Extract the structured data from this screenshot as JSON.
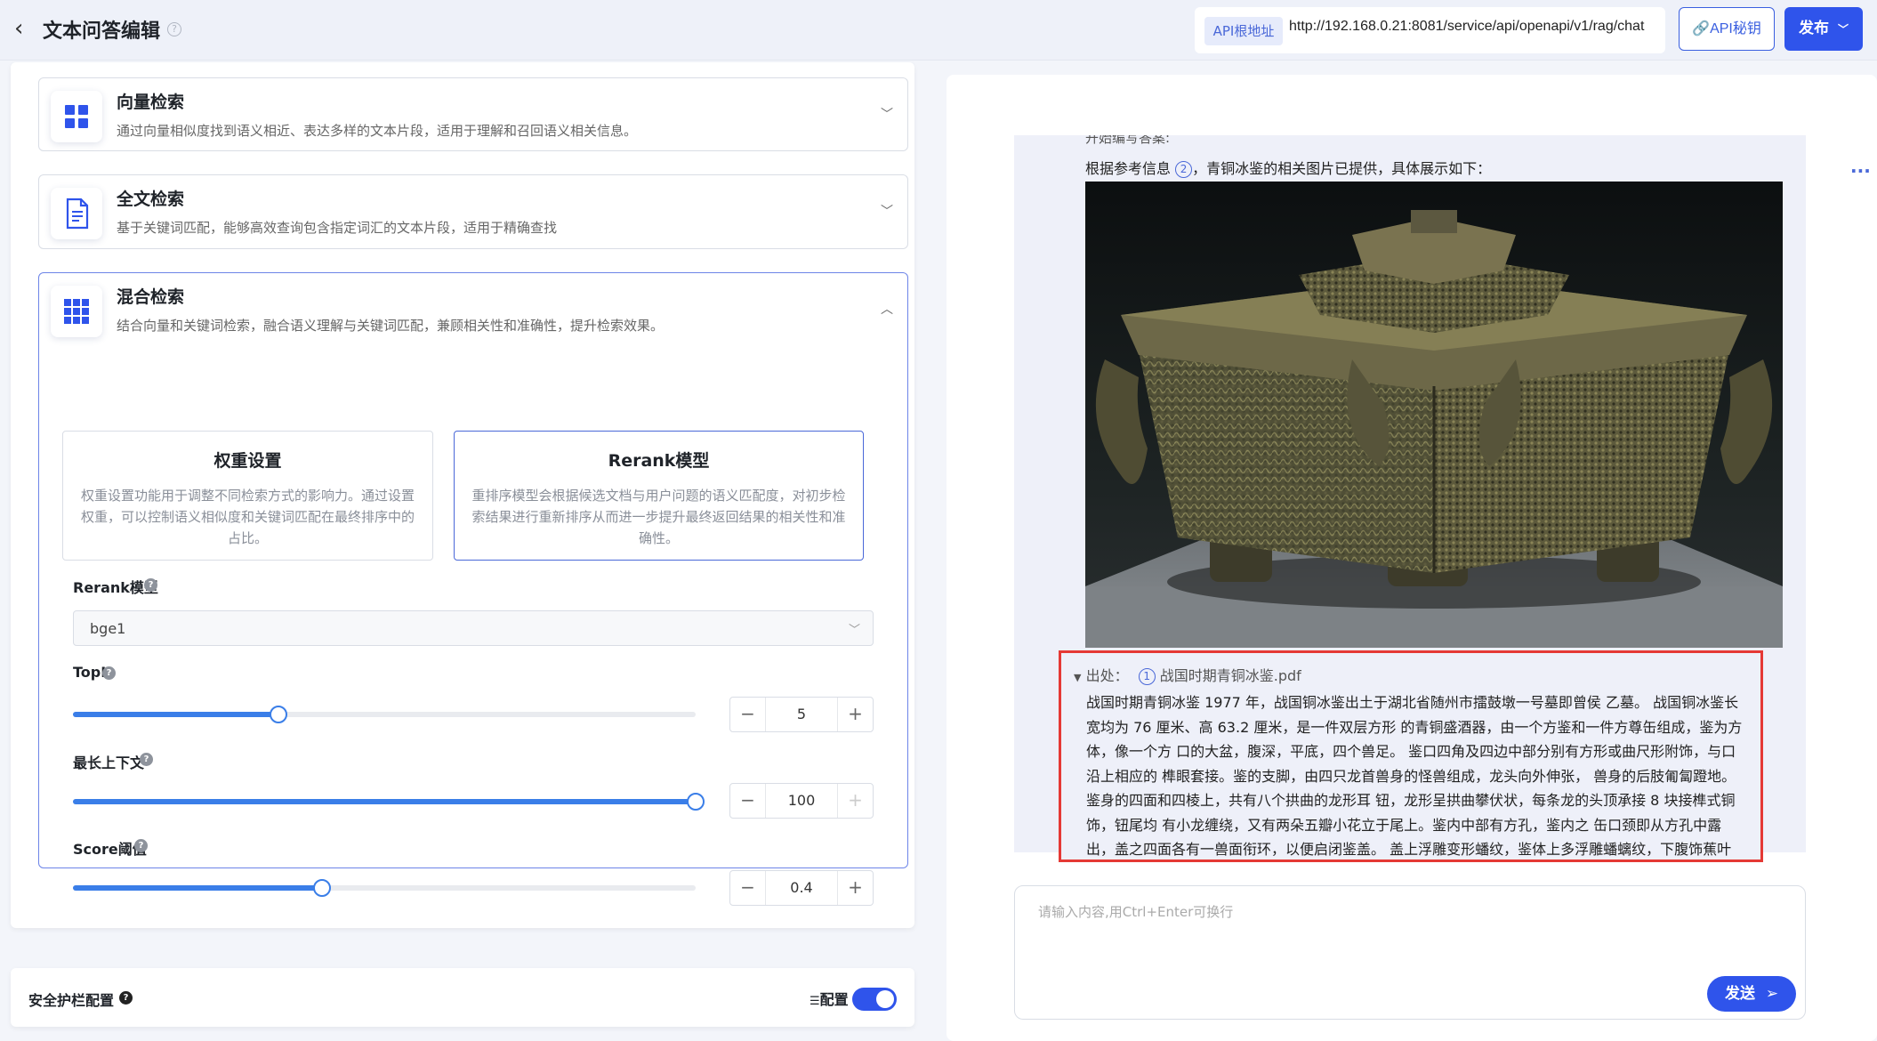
{
  "header": {
    "title": "文本问答编辑",
    "api_tag": "API根地址",
    "api_url": "http://192.168.0.21:8081/service/api/openapi/v1/rag/chat",
    "api_key_label": "API秘钥",
    "publish_label": "发布"
  },
  "retrieval": {
    "vector": {
      "title": "向量检索",
      "desc": "通过向量相似度找到语义相近、表达多样的文本片段，适用于理解和召回语义相关信息。"
    },
    "fulltext": {
      "title": "全文检索",
      "desc": "基于关键词匹配，能够高效查询包含指定词汇的文本片段，适用于精确查找"
    },
    "hybrid": {
      "title": "混合检索",
      "desc": "结合向量和关键词检索，融合语义理解与关键词匹配，兼顾相关性和准确性，提升检索效果。",
      "weight": {
        "title": "权重设置",
        "desc": "权重设置功能用于调整不同检索方式的影响力。通过设置权重，可以控制语义相似度和关键词匹配在最终排序中的占比。"
      },
      "rerank": {
        "title": "Rerank模型",
        "desc": "重排序模型会根据候选文档与用户问题的语义匹配度，对初步检索结果进行重新排序从而进一步提升最终返回结果的相关性和准确性。"
      },
      "rerank_model_label": "Rerank模型",
      "rerank_model_value": "bge1",
      "topk": {
        "label": "TopK",
        "value": "5",
        "fraction": 0.33
      },
      "max_context": {
        "label": "最长上下文",
        "value": "100",
        "fraction": 1.0
      },
      "score": {
        "label": "Score阈值",
        "value": "0.4",
        "fraction": 0.4
      }
    }
  },
  "guardrail": {
    "label": "安全护栏配置",
    "config_label": "配置",
    "enabled": true
  },
  "chat": {
    "more": "···",
    "cut_text": "开始编写答案:",
    "reply_prefix": "根据参考信息",
    "reply_ref": "2",
    "reply_suffix": "，青铜冰鉴的相关图片已提供，具体展示如下：",
    "source_prefix": "出处：",
    "source_ref": "1",
    "source_file": "战国时期青铜冰鉴.pdf",
    "source_text": "战国时期青铜冰鉴 1977 年，战国铜冰鉴出土于湖北省随州市擂鼓墩一号墓即曾侯 乙墓。 战国铜冰鉴长宽均为 76 厘米、高 63.2 厘米，是一件双层方形 的青铜盛酒器，由一个方鉴和一件方尊缶组成，鉴为方体，像一个方 口的大盆，腹深，平底，四个兽足。 鉴口四角及四边中部分别有方形或曲尺形附饰，与口沿上相应的 榫眼套接。鉴的支脚，由四只龙首兽身的怪兽组成，龙头向外伸张， 兽身的后肢匍匐蹬地。 鉴身的四面和四棱上，共有八个拱曲的龙形耳 钮，龙形呈拱曲攀伏状，每条龙的头顶承接 8 块接榫式铜饰，钮尾均 有小龙缠绕，又有两朵五瓣小花立于尾上。鉴内中部有方孔，鉴内之 缶口颈即从方孔中露出，盖之四面各有一兽面衔环，以便启闭鉴盖。 盖上浮雕变形蟠纹，鉴体上多浮雕蟠螭纹，下腹饰蕉叶"
  },
  "composer": {
    "placeholder": "请输入内容,用Ctrl+Enter可换行",
    "send_label": "发送"
  },
  "colors": {
    "accent": "#2f54eb",
    "slider": "#3a7ee8",
    "highlight": "#e53935"
  }
}
